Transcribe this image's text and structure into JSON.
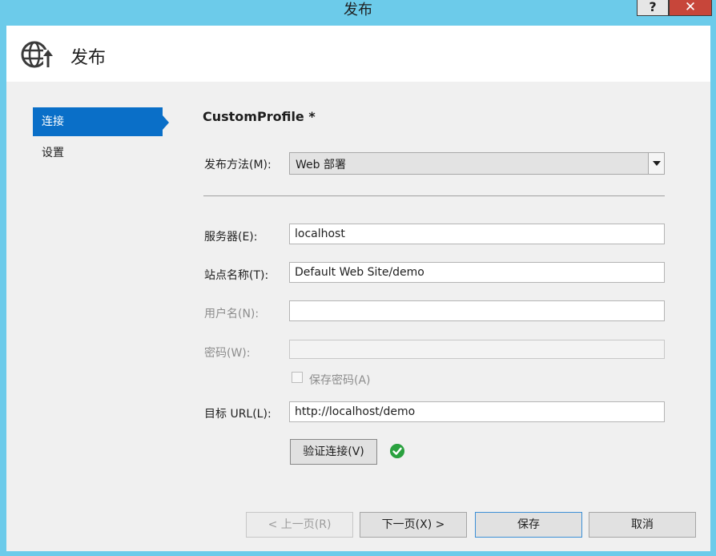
{
  "window": {
    "title": "发布",
    "help_label": "?",
    "close_label": "✕"
  },
  "header": {
    "title": "发布",
    "icon": "globe-publish-icon"
  },
  "sidebar": {
    "items": [
      {
        "label": "连接",
        "active": true
      },
      {
        "label": "设置",
        "active": false
      }
    ]
  },
  "form": {
    "profile_name": "CustomProfile *",
    "method_label": "发布方法(M):",
    "method_value": "Web 部署",
    "server_label": "服务器(E):",
    "server_value": "localhost",
    "site_label": "站点名称(T):",
    "site_value": "Default Web Site/demo",
    "username_label": "用户名(N):",
    "username_value": "",
    "password_label": "密码(W):",
    "password_value": "",
    "save_password_label": "保存密码(A)",
    "target_url_label": "目标 URL(L):",
    "target_url_value": "http://localhost/demo",
    "validate_label": "验证连接(V)",
    "validation_status_icon": "check-circle-icon"
  },
  "footer": {
    "prev_label": "< 上一页(R)",
    "next_label": "下一页(X) >",
    "save_label": "保存",
    "cancel_label": "取消"
  },
  "colors": {
    "titlebar": "#6ccbea",
    "accent": "#0a6fc8",
    "close": "#c7463a",
    "success": "#2aa13f"
  }
}
